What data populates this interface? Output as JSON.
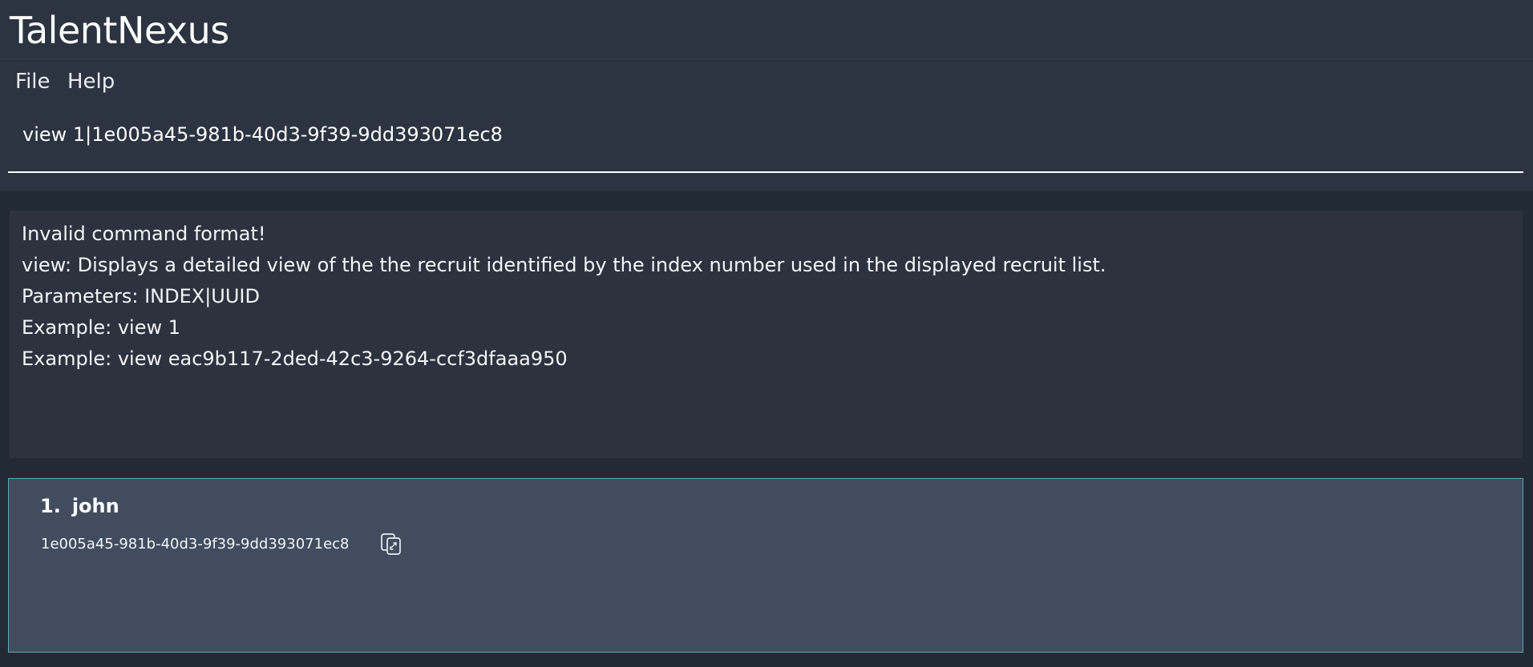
{
  "app": {
    "title": "TalentNexus"
  },
  "menu": {
    "items": [
      {
        "label": "File"
      },
      {
        "label": "Help"
      }
    ]
  },
  "command": {
    "value": "view 1|1e005a45-981b-40d3-9f39-9dd393071ec8"
  },
  "result": {
    "lines": [
      "Invalid command format!",
      "view: Displays a detailed view of the the recruit identified by the index number used in the displayed recruit list.",
      "Parameters: INDEX|UUID",
      "Example: view 1",
      "Example: view eac9b117-2ded-42c3-9264-ccf3dfaaa950"
    ]
  },
  "recruits": [
    {
      "index": "1.",
      "name": "john",
      "uuid": "1e005a45-981b-40d3-9f39-9dd393071ec8",
      "copy_icon": "copy-icon"
    }
  ],
  "colors": {
    "background": "#222b34",
    "panel": "#2b3440",
    "result_panel": "#2c333e",
    "recruit_card": "#414d5e",
    "selection_border": "#5fa7b5",
    "text": "#f2f4f7"
  }
}
